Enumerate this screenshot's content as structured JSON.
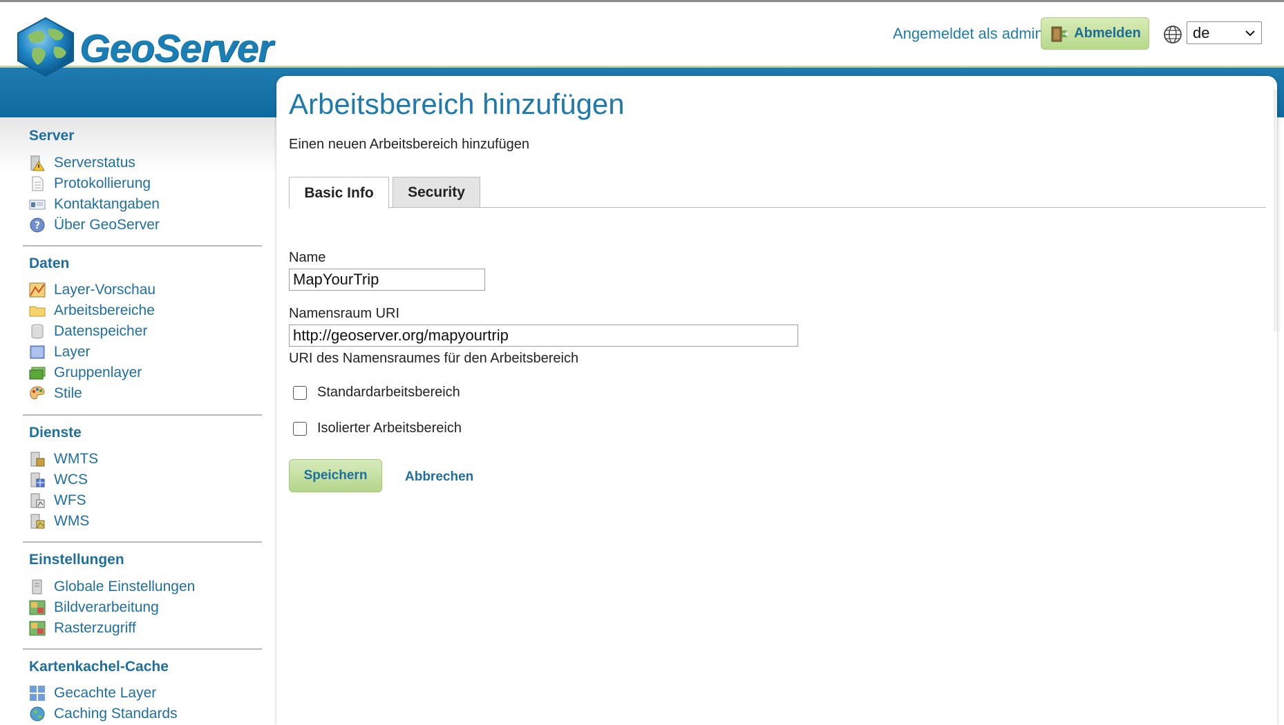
{
  "header": {
    "logo_text": "GeoServer",
    "login_status": "Angemeldet als admin.",
    "logout_label": "Abmelden",
    "language": "de"
  },
  "sidebar": {
    "sections": [
      {
        "title": "Server",
        "items": [
          {
            "label": "Serverstatus",
            "icon": "server-status-icon"
          },
          {
            "label": "Protokollierung",
            "icon": "logging-document-icon"
          },
          {
            "label": "Kontaktangaben",
            "icon": "contact-card-icon"
          },
          {
            "label": "Über GeoServer",
            "icon": "about-info-icon"
          }
        ]
      },
      {
        "title": "Daten",
        "items": [
          {
            "label": "Layer-Vorschau",
            "icon": "layer-preview-icon"
          },
          {
            "label": "Arbeitsbereiche",
            "icon": "folder-icon"
          },
          {
            "label": "Datenspeicher",
            "icon": "database-icon"
          },
          {
            "label": "Layer",
            "icon": "layer-icon"
          },
          {
            "label": "Gruppenlayer",
            "icon": "layer-group-icon"
          },
          {
            "label": "Stile",
            "icon": "palette-icon"
          }
        ]
      },
      {
        "title": "Dienste",
        "items": [
          {
            "label": "WMTS",
            "icon": "wmts-service-icon"
          },
          {
            "label": "WCS",
            "icon": "wcs-service-icon"
          },
          {
            "label": "WFS",
            "icon": "wfs-service-icon"
          },
          {
            "label": "WMS",
            "icon": "wms-service-icon"
          }
        ]
      },
      {
        "title": "Einstellungen",
        "items": [
          {
            "label": "Globale Einstellungen",
            "icon": "global-settings-icon"
          },
          {
            "label": "Bildverarbeitung",
            "icon": "image-processing-icon"
          },
          {
            "label": "Rasterzugriff",
            "icon": "raster-access-icon"
          }
        ]
      },
      {
        "title": "Kartenkachel-Cache",
        "items": [
          {
            "label": "Gecachte Layer",
            "icon": "tile-grid-icon"
          },
          {
            "label": "Caching Standards",
            "icon": "globe-icon"
          }
        ]
      }
    ]
  },
  "main": {
    "title": "Arbeitsbereich hinzufügen",
    "description": "Einen neuen Arbeitsbereich hinzufügen",
    "tabs": [
      {
        "label": "Basic Info",
        "active": true
      },
      {
        "label": "Security",
        "active": false
      }
    ],
    "form": {
      "name_label": "Name",
      "name_value": "MapYourTrip",
      "uri_label": "Namensraum URI",
      "uri_value": "http://geoserver.org/mapyourtrip",
      "uri_hint": "URI des Namensraumes für den Arbeitsbereich",
      "default_checkbox_label": "Standardarbeitsbereich",
      "default_checked": false,
      "isolated_checkbox_label": "Isolierter Arbeitsbereich",
      "isolated_checked": false
    },
    "save_label": "Speichern",
    "cancel_label": "Abbrechen"
  },
  "colors": {
    "brand_blue": "#1f7aac",
    "band_blue": "#1576ac",
    "button_green": "#b6d98a",
    "link_blue": "#1f6f9e"
  }
}
